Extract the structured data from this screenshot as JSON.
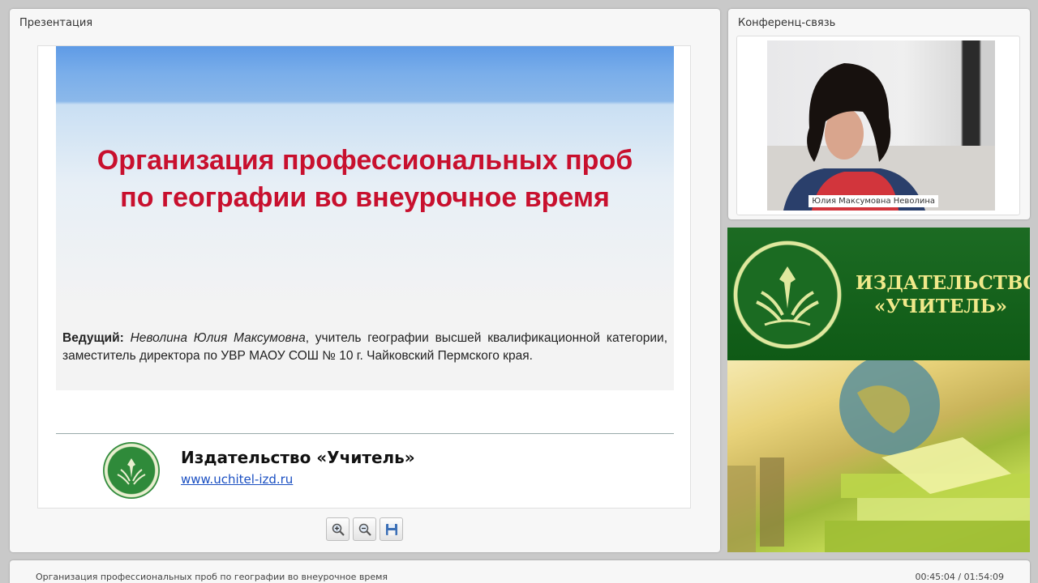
{
  "presentation_panel": {
    "title": "Презентация"
  },
  "conference_panel": {
    "title": "Конференц-связь",
    "participant_name": "Юлия Максумовна Неволина"
  },
  "slide": {
    "heading_line1": "Организация профессиональных проб",
    "heading_line2": "по географии во внеурочное время",
    "host_label": "Ведущий:",
    "host_name": "Неволина Юлия Максумовна",
    "host_details": ", учитель географии высшей квалификационной категории, заместитель директора по УВР МАОУ СОШ № 10 г. Чайковский Пермского края.",
    "publisher": "Издательство «Учитель»",
    "url": "www.uchitel-izd.ru"
  },
  "toolbar": {
    "zoom_in_icon": "zoom-in-icon",
    "zoom_out_icon": "zoom-out-icon",
    "save_icon": "floppy-disk-icon"
  },
  "banner": {
    "line1": "ИЗДАТЕЛЬСТВО",
    "line2": "«УЧИТЕЛЬ»"
  },
  "footer": {
    "title": "Организация профессиональных проб по географии во внеурочное время",
    "time": "00:45:04 / 01:54:09"
  },
  "colors": {
    "heading_red": "#c8102e",
    "banner_green": "#1c6b23",
    "banner_gold": "#f0e98a",
    "link_blue": "#1a4fc2"
  }
}
